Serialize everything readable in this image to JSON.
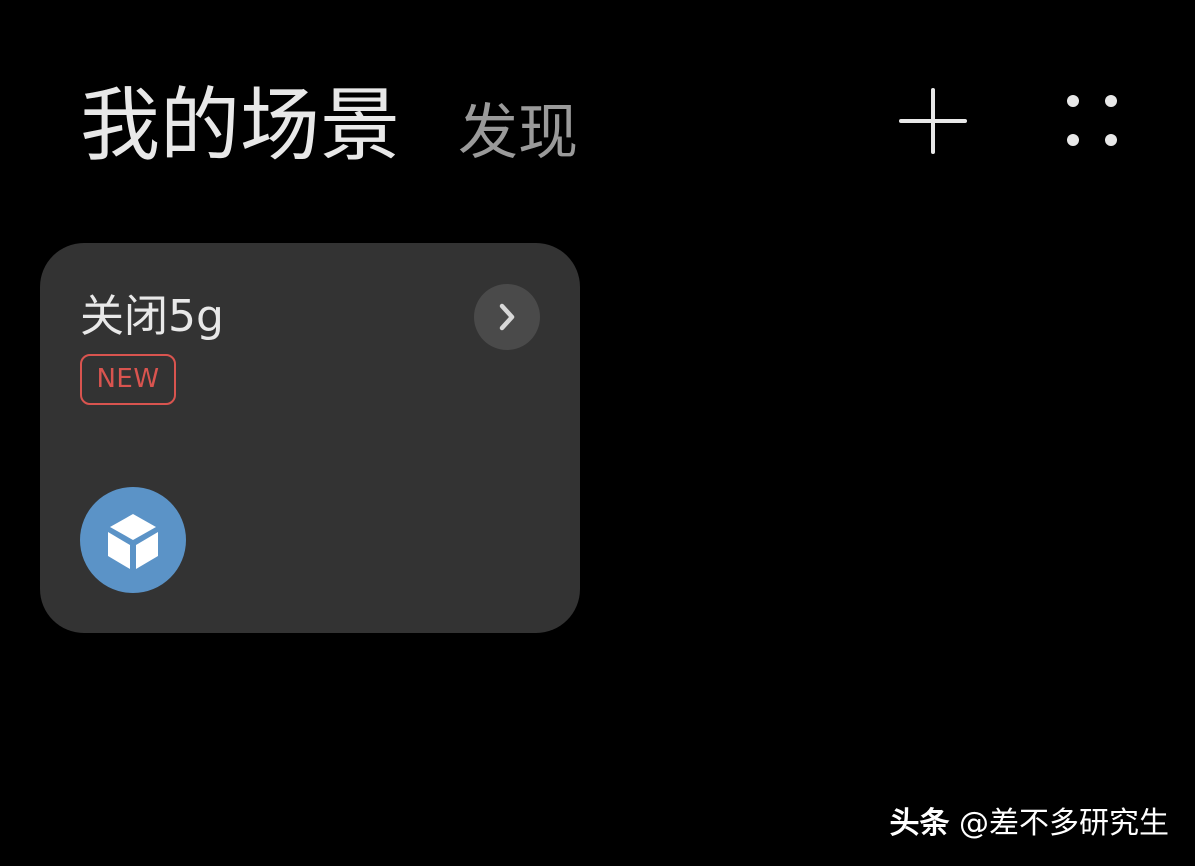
{
  "header": {
    "tabs": [
      {
        "label": "我的场景",
        "active": true
      },
      {
        "label": "发现",
        "active": false
      }
    ],
    "actions": {
      "add_icon": "plus-icon",
      "more_icon": "grid-dots-icon"
    }
  },
  "scenes": [
    {
      "title": "关闭5g",
      "badge": "NEW",
      "icon": "cube-icon",
      "action_icon": "chevron-right-icon"
    }
  ],
  "watermark": {
    "brand": "头条",
    "handle": "@差不多研究生"
  },
  "colors": {
    "background": "#000000",
    "card": "#333333",
    "badge": "#d9544f",
    "scene_icon_bg": "#5b93c7"
  }
}
